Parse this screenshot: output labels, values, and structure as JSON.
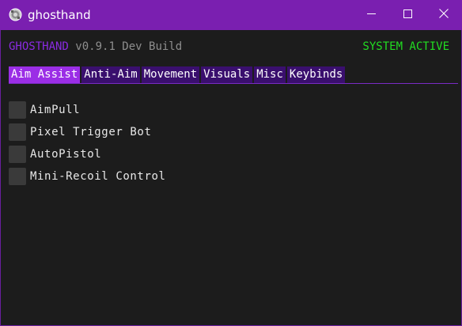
{
  "window": {
    "title": "ghosthand"
  },
  "header": {
    "brand": "GHOSTHAND",
    "version": "v0.9.1 Dev Build",
    "status": "SYSTEM ACTIVE",
    "brand_color": "#8a2be2",
    "status_color": "#22dd22"
  },
  "tabs": [
    {
      "label": "Aim Assist",
      "active": true
    },
    {
      "label": "Anti-Aim",
      "active": false
    },
    {
      "label": "Movement",
      "active": false
    },
    {
      "label": "Visuals",
      "active": false
    },
    {
      "label": "Misc",
      "active": false
    },
    {
      "label": "Keybinds",
      "active": false
    }
  ],
  "options": [
    {
      "label": "AimPull",
      "checked": false
    },
    {
      "label": "Pixel Trigger Bot",
      "checked": false
    },
    {
      "label": "AutoPistol",
      "checked": false
    },
    {
      "label": "Mini-Recoil Control",
      "checked": false
    }
  ],
  "icons": {
    "app": "ghost-app-icon",
    "minimize": "minimize-icon",
    "maximize": "maximize-icon",
    "close": "close-icon"
  }
}
